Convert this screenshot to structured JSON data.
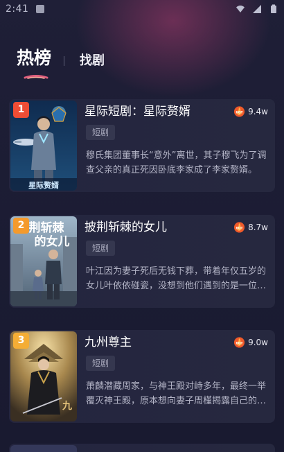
{
  "status_bar": {
    "time": "2:41",
    "icons": [
      "notification-icon",
      "wifi-icon",
      "signal-icon",
      "battery-icon"
    ]
  },
  "tabs": [
    {
      "label": "热榜",
      "active": true
    },
    {
      "label": "找剧",
      "active": false
    }
  ],
  "colors": {
    "background": "#1b1c33",
    "card": "#24253f",
    "rank_1": "#ef4d35",
    "rank_2": "#f49a2c",
    "rank_3": "#f4ad35",
    "hot_icon": "#f05a2a"
  },
  "items": [
    {
      "rank": "1",
      "title": "星际短剧：星际赘婿",
      "tag": "短剧",
      "heat": "9.4w",
      "description": "穆氏集团董事长“意外”离世，其子穆飞为了调查父亲的真正死因卧底李家成了李家赘婿。",
      "cover_icon": "sci-fi-soldier-cover"
    },
    {
      "rank": "2",
      "title": "披荆斩棘的女儿",
      "tag": "短剧",
      "heat": "8.7w",
      "description": "叶江因为妻子死后无钱下葬，带着年仅五岁的女儿叶依依碰瓷，没想到他们遇到的是一位大人物。",
      "cover_icon": "father-daughter-cover",
      "cover_text": [
        "荆斩棘",
        "的女儿"
      ]
    },
    {
      "rank": "3",
      "title": "九州尊主",
      "tag": "短剧",
      "heat": "9.0w",
      "description": "萧麟潜藏周家，与神王殿对峙多年，最终一举覆灭神王殿，原本想向妻子周槿揭露自己的身份。",
      "cover_icon": "ancient-swordsman-cover"
    }
  ]
}
